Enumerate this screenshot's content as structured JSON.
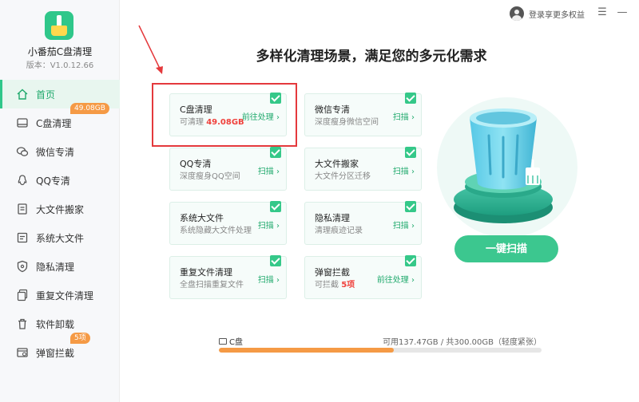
{
  "app": {
    "name": "小番茄C盘清理",
    "version": "版本：V1.0.12.66"
  },
  "sidebar": {
    "items": [
      {
        "label": "首页",
        "icon": "home-icon",
        "badge": ""
      },
      {
        "label": "C盘清理",
        "icon": "disk-icon",
        "badge": "49.08GB"
      },
      {
        "label": "微信专清",
        "icon": "wechat-icon",
        "badge": ""
      },
      {
        "label": "QQ专清",
        "icon": "qq-icon",
        "badge": ""
      },
      {
        "label": "大文件搬家",
        "icon": "file-move-icon",
        "badge": ""
      },
      {
        "label": "系统大文件",
        "icon": "system-file-icon",
        "badge": ""
      },
      {
        "label": "隐私清理",
        "icon": "shield-icon",
        "badge": ""
      },
      {
        "label": "重复文件清理",
        "icon": "duplicate-file-icon",
        "badge": ""
      },
      {
        "label": "软件卸载",
        "icon": "uninstall-icon",
        "badge": ""
      },
      {
        "label": "弹窗拦截",
        "icon": "popup-block-icon",
        "badge": "5项"
      }
    ]
  },
  "topbar": {
    "login": "登录享更多权益",
    "menu": "☰",
    "minimize": "—"
  },
  "headline": "多样化清理场景，满足您的多元化需求",
  "cards": [
    {
      "title": "C盘清理",
      "sub_prefix": "可清理 ",
      "sub_value": "49.08GB",
      "sub_suffix": "",
      "action": "前往处理 ›"
    },
    {
      "title": "微信专清",
      "sub_prefix": "深度瘦身微信空间",
      "sub_value": "",
      "sub_suffix": "",
      "action": "扫描 ›"
    },
    {
      "title": "QQ专清",
      "sub_prefix": "深度瘦身QQ空间",
      "sub_value": "",
      "sub_suffix": "",
      "action": "扫描 ›"
    },
    {
      "title": "大文件搬家",
      "sub_prefix": "大文件分区迁移",
      "sub_value": "",
      "sub_suffix": "",
      "action": "扫描 ›"
    },
    {
      "title": "系统大文件",
      "sub_prefix": "系统隐藏大文件处理",
      "sub_value": "",
      "sub_suffix": "",
      "action": "扫描 ›"
    },
    {
      "title": "隐私清理",
      "sub_prefix": "清理痕迹记录",
      "sub_value": "",
      "sub_suffix": "",
      "action": "扫描 ›"
    },
    {
      "title": "重复文件清理",
      "sub_prefix": "全盘扫描重复文件",
      "sub_value": "",
      "sub_suffix": "",
      "action": "扫描 ›"
    },
    {
      "title": "弹窗拦截",
      "sub_prefix": "可拦截 ",
      "sub_value": "5项",
      "sub_suffix": "",
      "action": "前往处理 ›"
    }
  ],
  "scan_button": "一键扫描",
  "disk": {
    "label": "C盘",
    "info": "可用137.47GB / 共300.00GB（轻度紧张）",
    "used_fraction": 0.542
  },
  "colors": {
    "accent": "#2fc78a",
    "badge": "#f59a45",
    "highlight": "#f0413c"
  }
}
